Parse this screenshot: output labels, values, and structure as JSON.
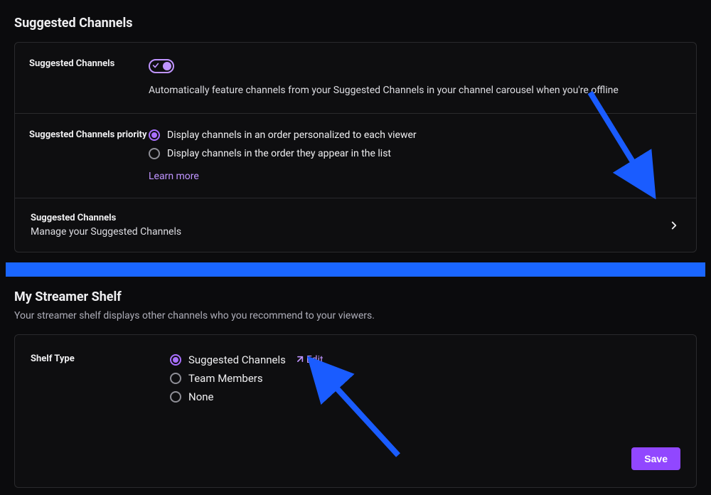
{
  "section1": {
    "title": "Suggested Channels",
    "toggle_row": {
      "label": "Suggested Channels",
      "state": "on",
      "description": "Automatically feature channels from your Suggested Channels in your channel carousel when you're offline"
    },
    "priority_row": {
      "label": "Suggested Channels priority",
      "options": [
        {
          "label": "Display channels in an order personalized to each viewer",
          "selected": true
        },
        {
          "label": "Display channels in the order they appear in the list",
          "selected": false
        }
      ],
      "learn_more": "Learn more"
    },
    "manage_row": {
      "title": "Suggested Channels",
      "subtitle": "Manage your Suggested Channels"
    }
  },
  "section2": {
    "title": "My Streamer Shelf",
    "subtitle": "Your streamer shelf displays other channels who you recommend to your viewers.",
    "shelf_type": {
      "label": "Shelf Type",
      "options": [
        {
          "label": "Suggested Channels",
          "selected": true,
          "edit": "Edit"
        },
        {
          "label": "Team Members",
          "selected": false
        },
        {
          "label": "None",
          "selected": false
        }
      ]
    },
    "save": "Save"
  }
}
